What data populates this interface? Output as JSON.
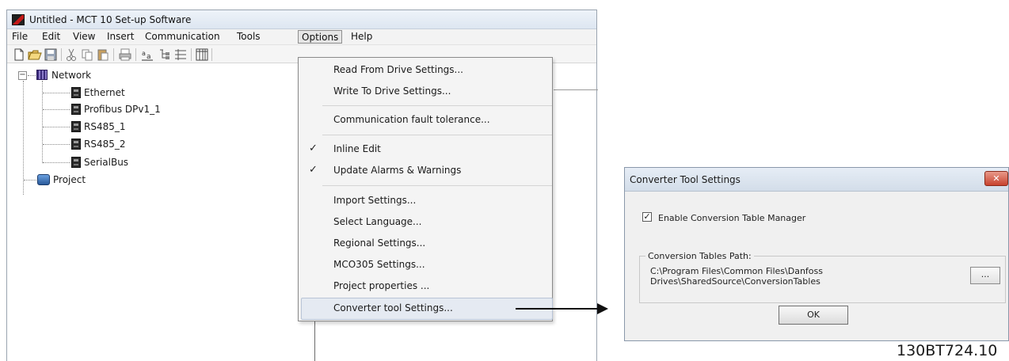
{
  "window": {
    "title": "Untitled - MCT 10 Set-up Software"
  },
  "menu": {
    "items": [
      {
        "label": "File"
      },
      {
        "label": "Edit"
      },
      {
        "label": "View"
      },
      {
        "label": "Insert"
      },
      {
        "label": "Communication"
      },
      {
        "label": "Tools"
      },
      {
        "label": "Options"
      },
      {
        "label": "Help"
      }
    ],
    "active": "Options"
  },
  "toolbar": {
    "icons": [
      "new-file-icon",
      "open-folder-icon",
      "save-icon",
      "cut-icon",
      "copy-icon",
      "paste-icon",
      "print-icon",
      "font-icon",
      "tree-view-icon",
      "list-view-icon",
      "columns-icon"
    ]
  },
  "tree": {
    "root": {
      "label": "Network",
      "expander": "−"
    },
    "children": [
      {
        "label": "Ethernet"
      },
      {
        "label": "Profibus DPv1_1"
      },
      {
        "label": "RS485_1"
      },
      {
        "label": "RS485_2"
      },
      {
        "label": "SerialBus"
      }
    ],
    "project": {
      "label": "Project"
    }
  },
  "options_menu": {
    "items": [
      {
        "label": "Read From Drive Settings..."
      },
      {
        "label": "Write To Drive Settings..."
      },
      {
        "label": "Communication fault tolerance..."
      },
      {
        "label": "Inline Edit",
        "checked": true
      },
      {
        "label": "Update Alarms & Warnings",
        "checked": true
      },
      {
        "label": "Import Settings..."
      },
      {
        "label": "Select Language..."
      },
      {
        "label": "Regional Settings..."
      },
      {
        "label": "MCO305 Settings..."
      },
      {
        "label": "Project properties ..."
      },
      {
        "label": "Converter tool Settings..."
      }
    ],
    "check_glyph": "✓",
    "highlighted": "Converter tool Settings..."
  },
  "dialog": {
    "title": "Converter Tool Settings",
    "close_glyph": "✕",
    "enable_checkbox": {
      "label": "Enable Conversion Table Manager",
      "checked": true,
      "glyph": "✓"
    },
    "group_label": "Conversion Tables Path:",
    "path_line1": "C:\\Program Files\\Common Files\\Danfoss",
    "path_line2": "Drives\\SharedSource\\ConversionTables",
    "browse_label": "...",
    "ok_label": "OK"
  },
  "caption": "130BT724.10",
  "colors": {
    "menu_highlight": "#e5eaf2",
    "close_button": "#c8432f",
    "arrow": "#111111"
  }
}
